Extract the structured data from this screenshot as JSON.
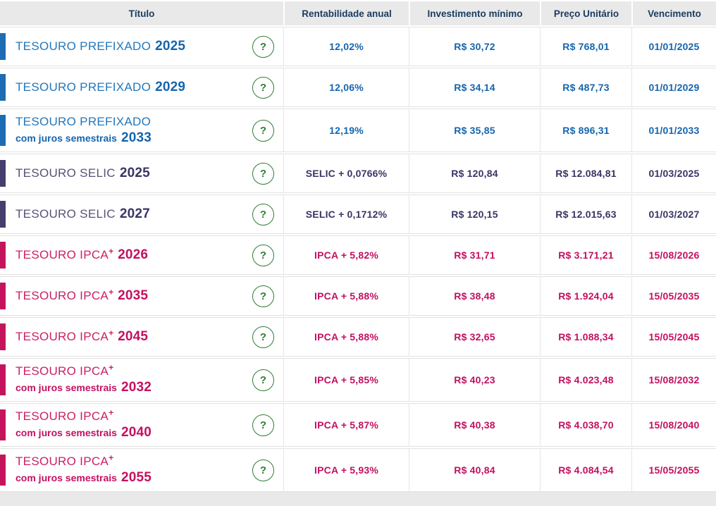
{
  "ui": {
    "help_symbol": "?"
  },
  "header": {
    "columns": [
      "Título",
      "Rentabilidade anual",
      "Investimento mínimo",
      "Preço Unitário",
      "Vencimento"
    ]
  },
  "themes": {
    "help_green": "#2e7d35",
    "header_bg": "#e9e9e9",
    "header_text": "#1b3c60",
    "blue": {
      "name": "#2377bb",
      "strong": "#1565ae",
      "bar": "#1d6cb4"
    },
    "purple": {
      "name": "#575278",
      "strong": "#383566",
      "bar": "#443f6c"
    },
    "pink": {
      "name": "#cb2064",
      "strong": "#c31060",
      "bar": "#c4155c"
    }
  },
  "rows": [
    {
      "theme": "blue",
      "name": "TESOURO PREFIXADO",
      "plus": "",
      "sub": "",
      "year": "2025",
      "rate": "12,02%",
      "min_investment": "R$ 30,72",
      "unit_price": "R$ 768,01",
      "maturity": "01/01/2025"
    },
    {
      "theme": "blue",
      "name": "TESOURO PREFIXADO",
      "plus": "",
      "sub": "",
      "year": "2029",
      "rate": "12,06%",
      "min_investment": "R$ 34,14",
      "unit_price": "R$ 487,73",
      "maturity": "01/01/2029"
    },
    {
      "theme": "blue",
      "name": "TESOURO PREFIXADO",
      "plus": "",
      "sub": "com juros semestrais",
      "year": "2033",
      "rate": "12,19%",
      "min_investment": "R$ 35,85",
      "unit_price": "R$ 896,31",
      "maturity": "01/01/2033"
    },
    {
      "theme": "purple",
      "name": "TESOURO SELIC",
      "plus": "",
      "sub": "",
      "year": "2025",
      "rate": "SELIC + 0,0766%",
      "min_investment": "R$ 120,84",
      "unit_price": "R$ 12.084,81",
      "maturity": "01/03/2025"
    },
    {
      "theme": "purple",
      "name": "TESOURO SELIC",
      "plus": "",
      "sub": "",
      "year": "2027",
      "rate": "SELIC + 0,1712%",
      "min_investment": "R$ 120,15",
      "unit_price": "R$ 12.015,63",
      "maturity": "01/03/2027"
    },
    {
      "theme": "pink",
      "name": "TESOURO IPCA",
      "plus": "+",
      "sub": "",
      "year": "2026",
      "rate": "IPCA + 5,82%",
      "min_investment": "R$ 31,71",
      "unit_price": "R$ 3.171,21",
      "maturity": "15/08/2026"
    },
    {
      "theme": "pink",
      "name": "TESOURO IPCA",
      "plus": "+",
      "sub": "",
      "year": "2035",
      "rate": "IPCA + 5,88%",
      "min_investment": "R$ 38,48",
      "unit_price": "R$ 1.924,04",
      "maturity": "15/05/2035"
    },
    {
      "theme": "pink",
      "name": "TESOURO IPCA",
      "plus": "+",
      "sub": "",
      "year": "2045",
      "rate": "IPCA + 5,88%",
      "min_investment": "R$ 32,65",
      "unit_price": "R$ 1.088,34",
      "maturity": "15/05/2045"
    },
    {
      "theme": "pink",
      "name": "TESOURO IPCA",
      "plus": "+",
      "sub": "com juros semestrais",
      "year": "2032",
      "rate": "IPCA + 5,85%",
      "min_investment": "R$ 40,23",
      "unit_price": "R$ 4.023,48",
      "maturity": "15/08/2032"
    },
    {
      "theme": "pink",
      "name": "TESOURO IPCA",
      "plus": "+",
      "sub": "com juros semestrais",
      "year": "2040",
      "rate": "IPCA + 5,87%",
      "min_investment": "R$ 40,38",
      "unit_price": "R$ 4.038,70",
      "maturity": "15/08/2040"
    },
    {
      "theme": "pink",
      "name": "TESOURO IPCA",
      "plus": "+",
      "sub": "com juros semestrais",
      "year": "2055",
      "rate": "IPCA + 5,93%",
      "min_investment": "R$ 40,84",
      "unit_price": "R$ 4.084,54",
      "maturity": "15/05/2055"
    }
  ]
}
